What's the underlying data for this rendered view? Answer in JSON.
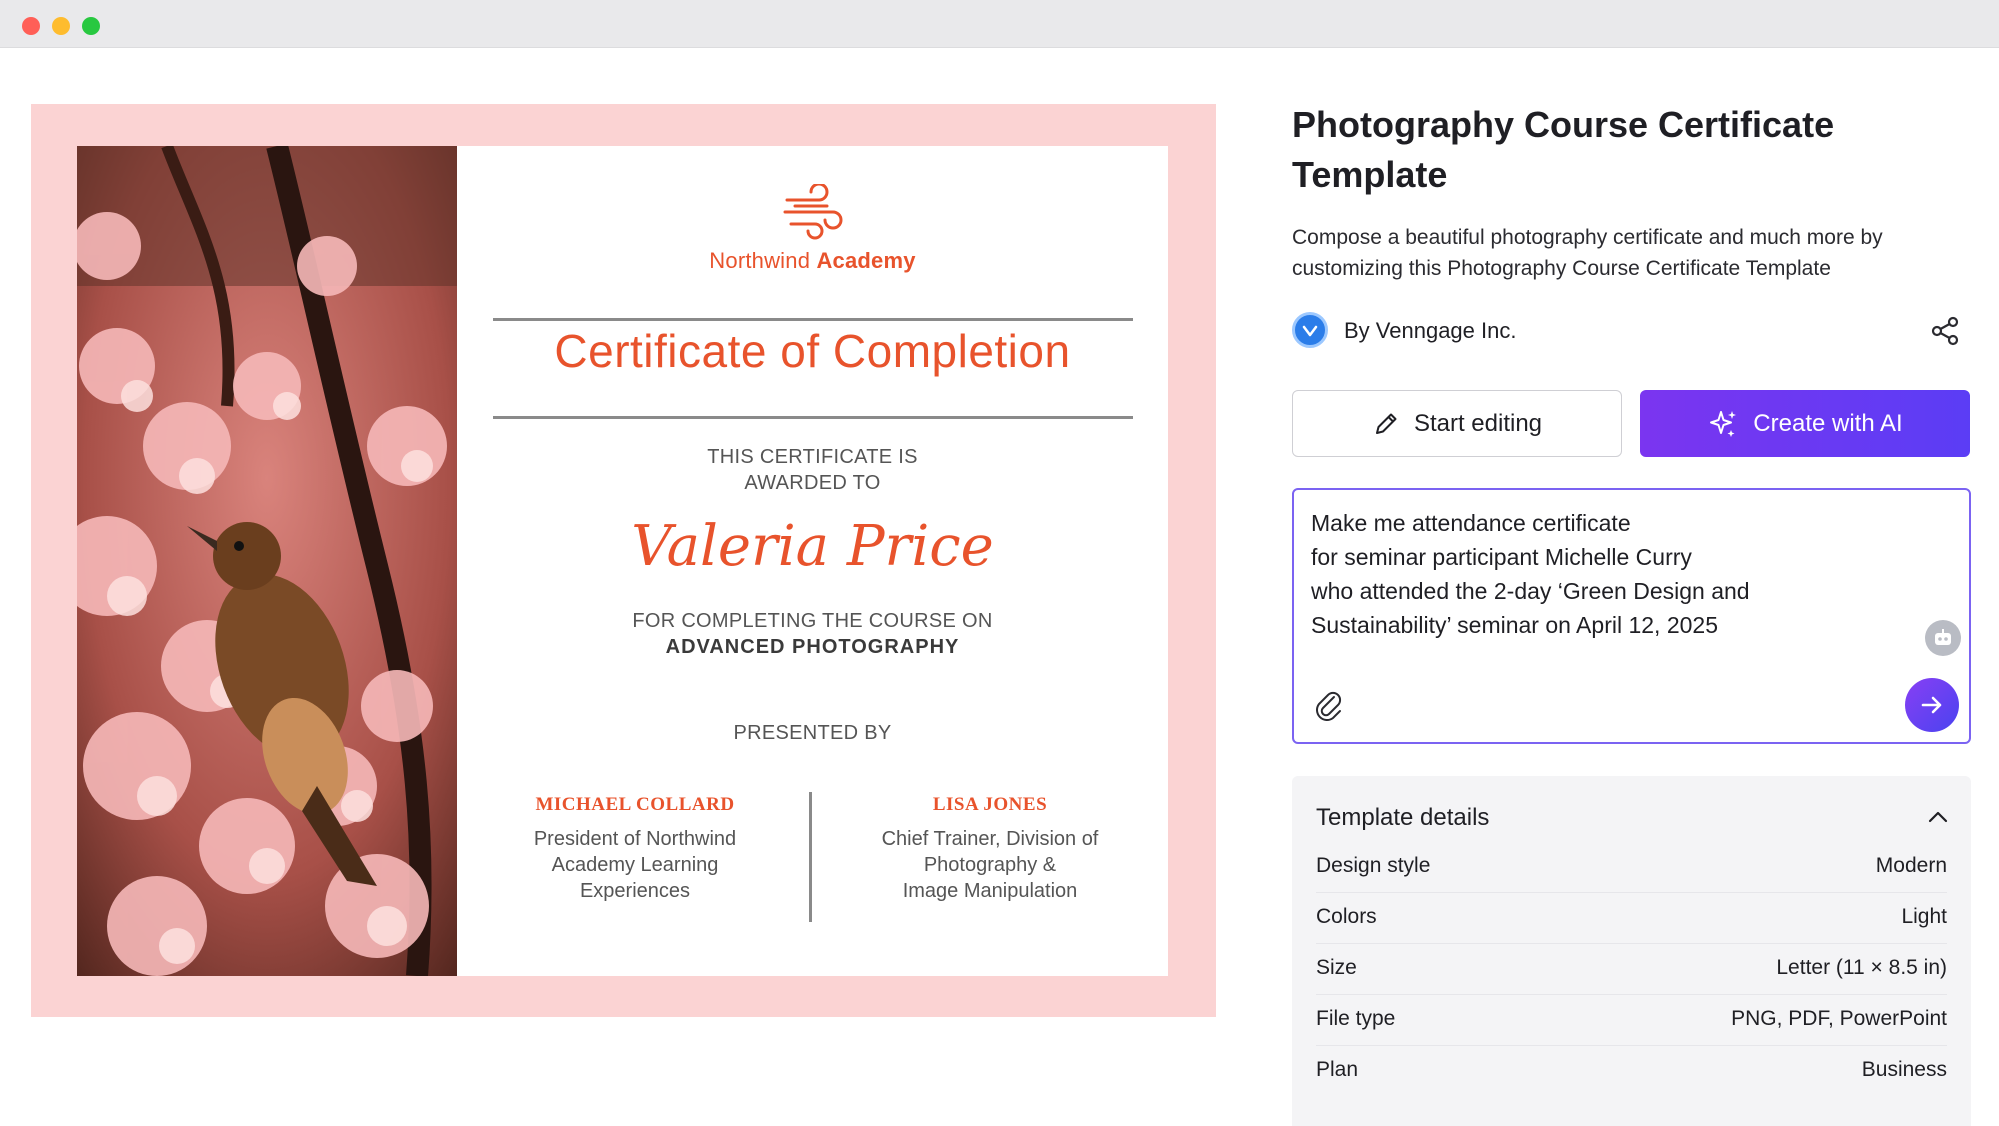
{
  "window": {
    "title": ""
  },
  "certificate": {
    "brand_light": "Northwind",
    "brand_bold": "Academy",
    "title": "Certificate of Completion",
    "awarded_line1": "THIS CERTIFICATE IS",
    "awarded_line2": "AWARDED TO",
    "recipient": "Valeria Price",
    "for_line": "FOR COMPLETING THE COURSE ON",
    "course": "ADVANCED PHOTOGRAPHY",
    "presented_by": "PRESENTED BY",
    "signers": [
      {
        "name": "MICHAEL COLLARD",
        "role_lines": [
          "President of Northwind",
          "Academy Learning",
          "Experiences"
        ]
      },
      {
        "name": "LISA JONES",
        "role_lines": [
          "Chief Trainer, Division of",
          "Photography &",
          "Image Manipulation"
        ]
      }
    ],
    "accent_color": "#e8532c",
    "frame_color": "#fbd3d3"
  },
  "panel": {
    "title": "Photography Course Certificate Template",
    "subtitle": "Compose a beautiful photography certificate and much more by customizing this Photography Course Certificate Template",
    "author": "By Venngage Inc.",
    "start_editing_label": "Start editing",
    "create_ai_label": "Create with AI",
    "prompt_text": "Make me attendance certificate\nfor seminar participant Michelle Curry\nwho attended the 2-day ‘Green Design and\nSustainability’ seminar on April 12, 2025",
    "details_heading": "Template details",
    "details": [
      {
        "key": "Design style",
        "value": "Modern"
      },
      {
        "key": "Colors",
        "value": "Light"
      },
      {
        "key": "Size",
        "value": "Letter (11 × 8.5 in)"
      },
      {
        "key": "File type",
        "value": "PNG, PDF, PowerPoint"
      },
      {
        "key": "Plan",
        "value": "Business"
      }
    ],
    "ai_gradient": [
      "#7b35f0",
      "#5b3df5"
    ]
  },
  "icons": {
    "logo": "wind-logo-icon",
    "share": "share-icon",
    "edit": "pencil-icon",
    "ai": "sparkles-icon",
    "attach": "paperclip-icon",
    "send": "arrow-right-icon",
    "bot": "bot-icon",
    "collapse": "chevron-up-icon"
  }
}
